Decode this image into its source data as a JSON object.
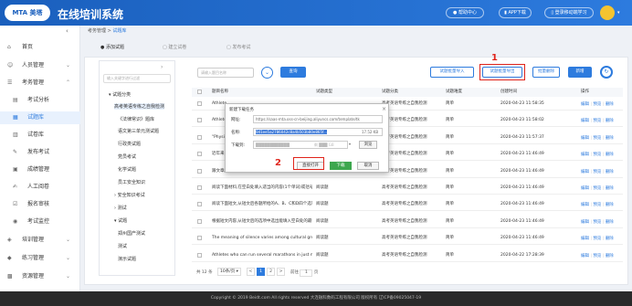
{
  "header": {
    "logo": "MTA 美塔",
    "title": "在线培训系统",
    "help": "帮助中心",
    "app": "APP下载",
    "login": "登录移动端学习"
  },
  "sidebar": {
    "items": [
      {
        "icon": "home-icon",
        "label": "首页",
        "arrow": ""
      },
      {
        "icon": "user-icon",
        "label": "人员管理",
        "arrow": "⌄"
      },
      {
        "icon": "exam-icon",
        "label": "考务管理",
        "arrow": "⌃"
      },
      {
        "icon": "chart-icon",
        "label": "考试分析",
        "arrow": ""
      },
      {
        "icon": "bank-icon",
        "label": "试题库",
        "arrow": ""
      },
      {
        "icon": "paper-icon",
        "label": "试卷库",
        "arrow": ""
      },
      {
        "icon": "publish-icon",
        "label": "发布考试",
        "arrow": ""
      },
      {
        "icon": "score-icon",
        "label": "成绩管理",
        "arrow": ""
      },
      {
        "icon": "grade-icon",
        "label": "人工阅卷",
        "arrow": ""
      },
      {
        "icon": "review-icon",
        "label": "报名审核",
        "arrow": ""
      },
      {
        "icon": "monitor-icon",
        "label": "考试监控",
        "arrow": ""
      },
      {
        "icon": "train-icon",
        "label": "培训管理",
        "arrow": "⌄"
      },
      {
        "icon": "practice-icon",
        "label": "练习管理",
        "arrow": "⌄"
      },
      {
        "icon": "resource-icon",
        "label": "资源管理",
        "arrow": "⌄"
      }
    ]
  },
  "breadcrumb": {
    "parent": "考务管理",
    "sep": ">",
    "current": "试题库"
  },
  "steps": {
    "s1": "添加试题",
    "s2": "建立试卷",
    "s3": "发布考试"
  },
  "tree": {
    "search_placeholder": "输入关键字进行过滤",
    "nodes": [
      "试题分类",
      "高考英语专练之自我检测",
      "《法律常识》题库",
      "语文第三单元测试题",
      "行政类试题",
      "党员考试",
      "化学试题",
      "员工安全知识",
      "安全知识考试",
      "测试",
      "试题",
      "郑州国产测试",
      "测试",
      "演示试题"
    ]
  },
  "toolbar": {
    "name_placeholder": "请输入题目名称",
    "search": "查询",
    "import": "试题批量导入",
    "export": "试题批量导出",
    "batch_delete": "批量删除",
    "add": "新增"
  },
  "table": {
    "headers": [
      "题目名称",
      "试题类型",
      "试题分类",
      "试题难度",
      "创建时间",
      "操作"
    ],
    "rows": [
      {
        "name": "Athlete",
        "type": "",
        "category": "高考英语专练之自我检测",
        "difficulty": "简单",
        "time": "2020-04-23 11:58:35"
      },
      {
        "name": "Athlete",
        "type": "",
        "category": "高考英语专练之自我检测",
        "difficulty": "简单",
        "time": "2020-04-23 11:58:02"
      },
      {
        "name": "\"Physi",
        "type": "",
        "category": "高考英语专练之自我检测",
        "difficulty": "简单",
        "time": "2020-04-23 11:57:37"
      },
      {
        "name": "近年来",
        "type": "",
        "category": "高考英语专练之自我检测",
        "difficulty": "简单",
        "time": "2020-04-23 11:46:49"
      },
      {
        "name": "跟文章所给信息,从ABCD四个选项中选出最佳选项",
        "type": "阅读题",
        "category": "高考英语专练之自我检测",
        "difficulty": "简单",
        "time": "2020-04-23 11:46:49"
      },
      {
        "name": "阅读下面材料,在空白处填入适当的内容(1个单词)或括号",
        "type": "阅读题",
        "category": "高考英语专练之自我检测",
        "difficulty": "简单",
        "time": "2020-04-23 11:46:49"
      },
      {
        "name": "阅读下面短文,从短文后各题所给的A、B、C和D四个选项中",
        "type": "阅读题",
        "category": "高考英语专练之自我检测",
        "difficulty": "简单",
        "time": "2020-04-23 11:46:49"
      },
      {
        "name": "根据短文内容,从短文后的选项中选出能填入空白处的最佳",
        "type": "阅读题",
        "category": "高考英语专练之自我检测",
        "difficulty": "简单",
        "time": "2020-04-23 11:46:49"
      },
      {
        "name": "The meaning of silence varies among cultural grou",
        "type": "阅读题",
        "category": "高考英语专练之自我检测",
        "difficulty": "简单",
        "time": "2020-04-23 11:46:49"
      },
      {
        "name": "Athletes who can run several marathons in just mo",
        "type": "阅读题",
        "category": "高考英语专练之自我检测",
        "difficulty": "简单",
        "time": "2020-04-22 17:28:39"
      }
    ],
    "ops": {
      "edit": "编辑",
      "preview": "预览",
      "delete": "删除",
      "sep": "|"
    }
  },
  "pagination": {
    "total": "共 12 条",
    "size": "10条/页",
    "p1": "1",
    "p2": "2",
    "prev": "<",
    "next": ">",
    "goto": "前往",
    "page": "1",
    "page_unit": "页"
  },
  "dialog": {
    "title": "新建下载任务",
    "url_label": "网址:",
    "url": "https://saas-mta.oss-cn-beijing.aliyuncs.com/template/tk",
    "name_label": "名称:",
    "name": "0d1ee5a2786042c8a4b503b80e865f...",
    "size": "17.52 KB",
    "dir_label": "下载到:",
    "dir": "████████████",
    "dir_size": "剩 ███ GB",
    "browse": "浏览",
    "open": "直接打开",
    "download": "下载",
    "cancel": "取消"
  },
  "annotations": {
    "one": "1",
    "two": "2"
  },
  "footer": "Copyright © 2019 Beidt.com All rights reserved 大连融科数码工程有限公司 版权所有 辽ICP备09025047-19"
}
